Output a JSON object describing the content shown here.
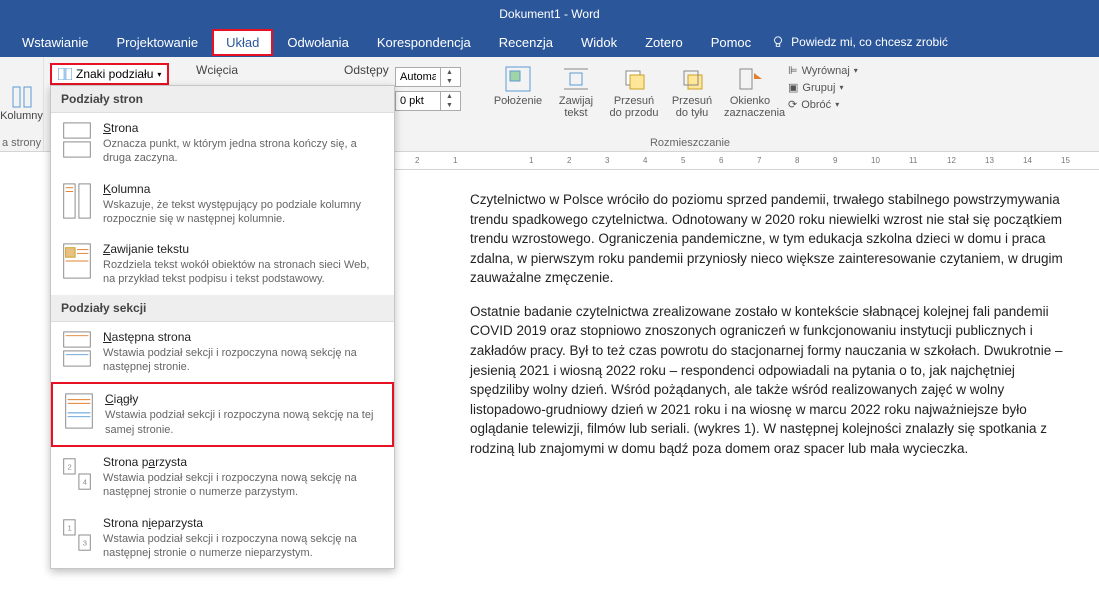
{
  "title": "Dokument1 - Word",
  "menu": {
    "wstawianie": "Wstawianie",
    "projektowanie": "Projektowanie",
    "uklad": "Układ",
    "odwolania": "Odwołania",
    "korespondencja": "Korespondencja",
    "recenzja": "Recenzja",
    "widok": "Widok",
    "zotero": "Zotero",
    "pomoc": "Pomoc",
    "tellme": "Powiedz mi, co chcesz zrobić"
  },
  "ribbon": {
    "kolumny": "Kolumny",
    "astrony": "a strony",
    "breaks_btn": "Znaki podziału",
    "wciecia": "Wcięcia",
    "odstepy": "Odstępy",
    "spin1": "Automatycz",
    "spin2": "0 pkt",
    "rozmieszczanie": "Rozmieszczanie",
    "polozenie": "Położenie",
    "zawijaj": "Zawijaj tekst",
    "przesun_przod": "Przesuń do przodu",
    "przesun_tyl": "Przesuń do tyłu",
    "okienko": "Okienko zaznaczenia",
    "wyrownaj": "Wyrównaj",
    "grupuj": "Grupuj",
    "obroc": "Obróć"
  },
  "dropdown": {
    "sec_page": "Podziały stron",
    "strona_t": "Strona",
    "strona_d": "Oznacza punkt, w którym jedna strona kończy się, a druga zaczyna.",
    "kolumna_t": "Kolumna",
    "kolumna_d": "Wskazuje, że tekst występujący po podziale kolumny rozpocznie się w następnej kolumnie.",
    "zaw_t": "Zawijanie tekstu",
    "zaw_d": "Rozdziela tekst wokół obiektów na stronach sieci Web, na przykład tekst podpisu i tekst podstawowy.",
    "sec_sec": "Podziały sekcji",
    "nast_t": "Następna strona",
    "nast_d": "Wstawia podział sekcji i rozpoczyna nową sekcję na następnej stronie.",
    "ciag_t": "Ciągły",
    "ciag_d": "Wstawia podział sekcji i rozpoczyna nową sekcję na tej samej stronie.",
    "parz_t": "Strona parzysta",
    "parz_d": "Wstawia podział sekcji i rozpoczyna nową sekcję na następnej stronie o numerze parzystym.",
    "nparz_t": "Strona nieparzysta",
    "nparz_d": "Wstawia podział sekcji i rozpoczyna nową sekcję na następnej stronie o numerze nieparzystym."
  },
  "doc": {
    "p1": "Czytelnictwo w Polsce wróciło do poziomu sprzed pandemii, trwałego stabilnego powstrzymywania trendu spadkowego czytelnictwa. Odnotowany w 2020 roku niewielki wzrost nie stał się początkiem trendu wzrostowego. Ograniczenia pandemiczne, w tym edukacja szkolna dzieci w domu i praca zdalna, w pierwszym roku pandemii przyniosły nieco większe zainteresowanie czytaniem, w drugim zauważalne zmęczenie.",
    "p2": "Ostatnie badanie czytelnictwa zrealizowane zostało w kontekście słabnącej kolejnej fali pandemii COVID 2019 oraz stopniowo znoszonych ograniczeń w funkcjonowaniu instytucji publicznych i zakładów pracy. Był to też czas powrotu do stacjonarnej formy nauczania w szkołach. Dwukrotnie – jesienią 2021 i wiosną 2022 roku – respondenci odpowiadali na pytania o to, jak najchętniej spędziliby wolny dzień. Wśród pożądanych, ale także wśród realizowanych zajęć w wolny listopadowo-grudniowy dzień w 2021 roku i na wiosnę w marcu 2022 roku najważniejsze było oglądanie telewizji, filmów lub seriali. (wykres 1). W następnej kolejności znalazły się spotkania z rodziną lub znajomymi w domu bądź poza domem oraz spacer lub mała wycieczka."
  },
  "ruler": [
    "2",
    "1",
    "",
    "1",
    "2",
    "3",
    "4",
    "5",
    "6",
    "7",
    "8",
    "9",
    "10",
    "11",
    "12",
    "13",
    "14",
    "15"
  ]
}
